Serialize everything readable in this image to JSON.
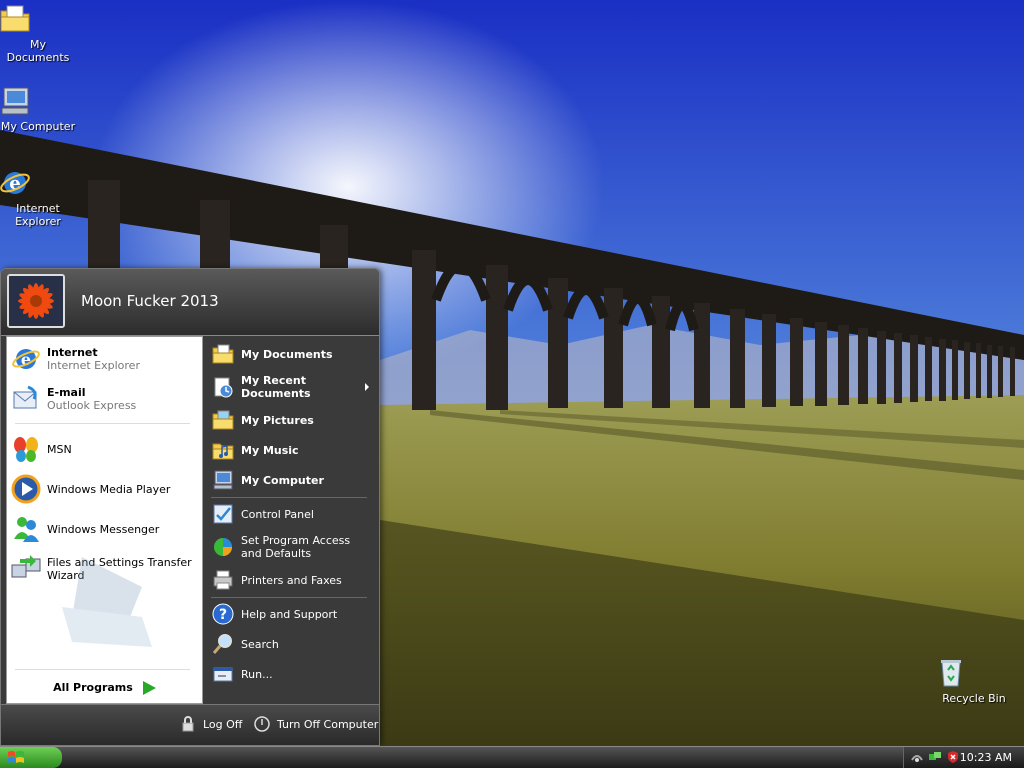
{
  "desktop": {
    "icons": [
      {
        "label": "My Documents",
        "icon": "my-documents-icon"
      },
      {
        "label": "My Computer",
        "icon": "my-computer-icon"
      },
      {
        "label": "Internet Explorer",
        "icon": "internet-explorer-icon"
      },
      {
        "label": "Recycle Bin",
        "icon": "recycle-bin-icon"
      }
    ]
  },
  "start_menu": {
    "user_name": "Moon Fucker 2013",
    "left": {
      "pinned": [
        {
          "title": "Internet",
          "subtitle": "Internet Explorer",
          "icon": "internet-explorer-icon"
        },
        {
          "title": "E-mail",
          "subtitle": "Outlook Express",
          "icon": "email-icon"
        }
      ],
      "recent": [
        {
          "label": "MSN",
          "icon": "msn-butterfly-icon"
        },
        {
          "label": "Windows Media Player",
          "icon": "media-player-icon"
        },
        {
          "label": "Windows Messenger",
          "icon": "messenger-icon"
        },
        {
          "label": "Files and Settings Transfer Wizard",
          "icon": "transfer-wizard-icon"
        }
      ],
      "all_programs": "All Programs"
    },
    "right": {
      "places": [
        {
          "label": "My Documents",
          "icon": "folder-documents-icon"
        },
        {
          "label": "My Recent Documents",
          "icon": "recent-documents-icon"
        },
        {
          "label": "My Pictures",
          "icon": "folder-pictures-icon"
        },
        {
          "label": "My Music",
          "icon": "folder-music-icon"
        },
        {
          "label": "My Computer",
          "icon": "my-computer-icon"
        }
      ],
      "settings": [
        {
          "label": "Control Panel",
          "icon": "control-panel-icon"
        },
        {
          "label": "Set Program Access and Defaults",
          "icon": "program-access-icon"
        },
        {
          "label": "Printers and Faxes",
          "icon": "printer-icon"
        }
      ],
      "tools": [
        {
          "label": "Help and Support",
          "icon": "help-icon"
        },
        {
          "label": "Search",
          "icon": "search-icon"
        },
        {
          "label": "Run...",
          "icon": "run-icon"
        }
      ]
    },
    "footer": {
      "log_off": "Log Off",
      "turn_off": "Turn Off Computer"
    }
  },
  "taskbar": {
    "clock": "10:23 AM"
  },
  "colors": {
    "sky_top": "#1c36c8",
    "sky_bottom": "#b8c8f0",
    "grass": "#8a8a3a",
    "start_green": "#3aa82a"
  }
}
